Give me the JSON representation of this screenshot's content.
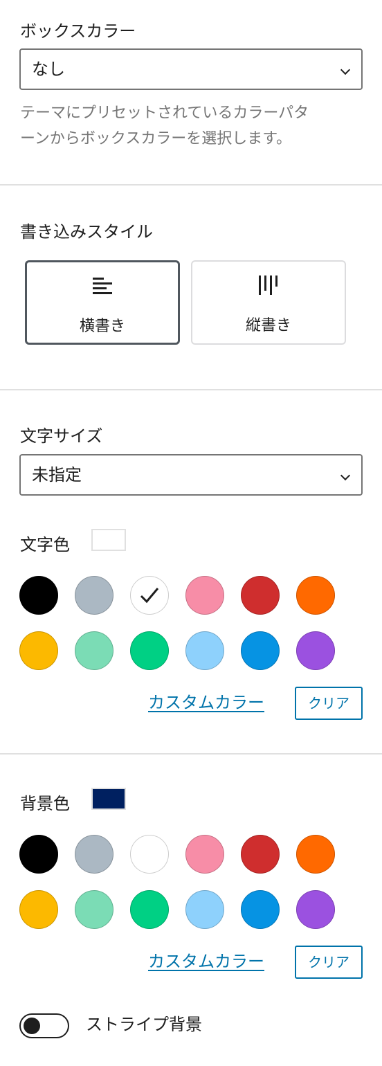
{
  "box_color": {
    "label": "ボックスカラー",
    "selected": "なし",
    "help_line1": "テーマにプリセットされているカラーパタ",
    "help_line2": "ーンからボックスカラーを選択します。"
  },
  "writing_mode": {
    "label": "書き込みスタイル",
    "options": [
      {
        "label": "横書き",
        "icon": "align-left-icon",
        "active": true
      },
      {
        "label": "縦書き",
        "icon": "vertical-text-icon",
        "active": false
      }
    ]
  },
  "font_size": {
    "label": "文字サイズ",
    "selected": "未指定"
  },
  "text_color": {
    "label": "文字色",
    "current_color": "#ffffff",
    "selected_index": 2,
    "custom_label": "カスタムカラー",
    "clear_label": "クリア"
  },
  "background_color": {
    "label": "背景色",
    "current_color": "#002060",
    "custom_label": "カスタムカラー",
    "clear_label": "クリア"
  },
  "palette": [
    "#000000",
    "#abb8c3",
    "#ffffff",
    "#f78da7",
    "#cf2e2e",
    "#ff6900",
    "#fcb900",
    "#7bdcb5",
    "#00d084",
    "#8ed1fc",
    "#0693e3",
    "#9b51e0"
  ],
  "stripe": {
    "label": "ストライプ背景",
    "enabled": false
  }
}
